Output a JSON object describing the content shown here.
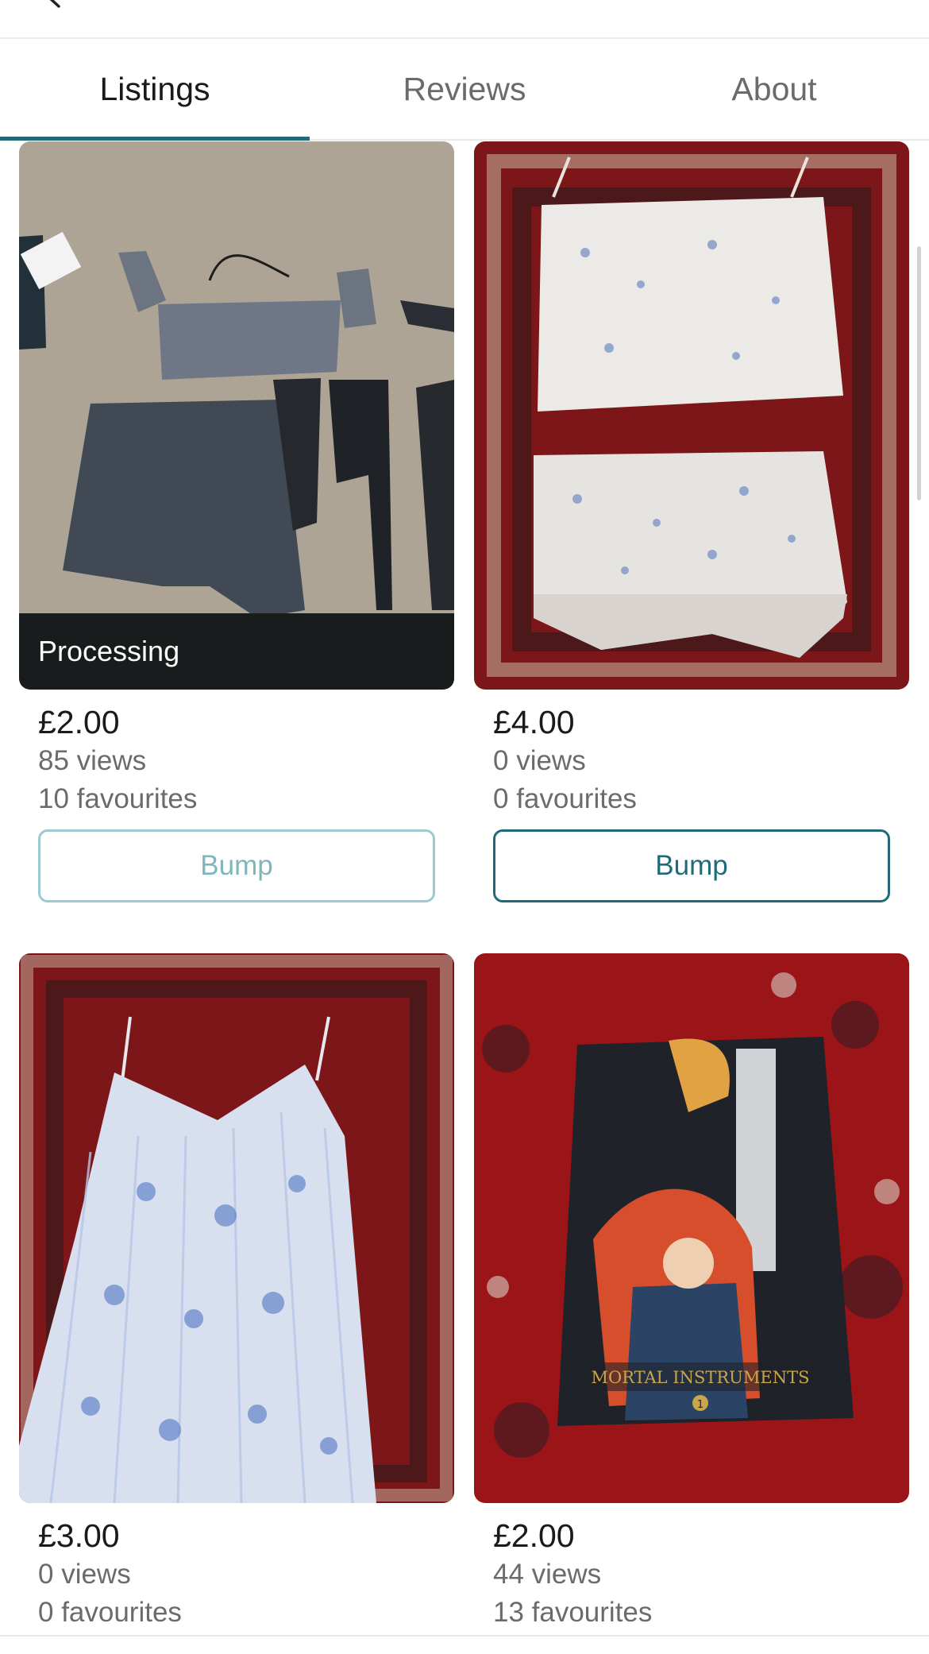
{
  "header": {
    "back_icon": "back-arrow-icon"
  },
  "tabs": [
    {
      "label": "Listings",
      "active": true
    },
    {
      "label": "Reviews",
      "active": false
    },
    {
      "label": "About",
      "active": false
    }
  ],
  "listings": [
    {
      "price": "£2.00",
      "views": "85 views",
      "favourites": "10 favourites",
      "status": "Processing",
      "button": "Bump",
      "button_enabled": false
    },
    {
      "price": "£4.00",
      "views": "0 views",
      "favourites": "0 favourites",
      "button": "Bump",
      "button_enabled": true
    },
    {
      "price": "£3.00",
      "views": "0 views",
      "favourites": "0 favourites"
    },
    {
      "price": "£2.00",
      "views": "44 views",
      "favourites": "13 favourites"
    }
  ],
  "book_cover": {
    "title": "MORTAL INSTRUMENTS",
    "volume": "1"
  },
  "colors": {
    "accent": "#1f6c78",
    "accent_disabled": "#9ccbcf",
    "overlay": "#181c1d"
  }
}
